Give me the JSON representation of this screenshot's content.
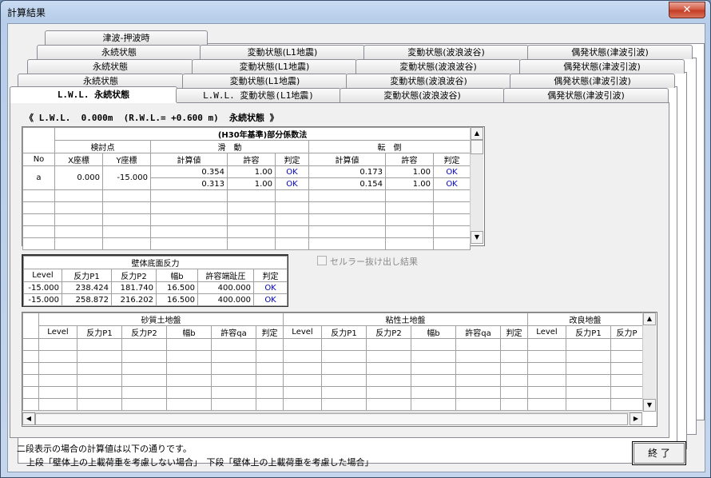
{
  "window": {
    "title": "計算結果",
    "close_glyph": "✕"
  },
  "tabs_row1": [
    "津波-押波時"
  ],
  "tabs_row2": [
    "永続状態",
    "変動状態(L1地震)",
    "変動状態(波浪波谷)",
    "偶発状態(津波引波)"
  ],
  "tabs_row3": [
    "永続状態",
    "変動状態(L1地震)",
    "変動状態(波浪波谷)",
    "偶発状態(津波引波)"
  ],
  "tabs_row4": [
    "永続状態",
    "変動状態(L1地震)",
    "変動状態(波浪波谷)",
    "偶発状態(津波引波)"
  ],
  "tabs_front": [
    "L.W.L. 永続状態",
    "L.W.L. 変動状態(L1地震)",
    "変動状態(波浪波谷)",
    "偶発状態(津波引波)"
  ],
  "heading": "《 L.W.L.  0.000m  (R.W.L.= +0.600 m)  永続状態 》",
  "main_table": {
    "title": "(H30年基準)部分係数法",
    "col_no": "No",
    "group_check": "検討点",
    "group_slide": "滑　動",
    "group_overturn": "転　倒",
    "x": "X座標",
    "y": "Y座標",
    "calc": "計算値",
    "allow": "許容",
    "judge": "判定",
    "rows": [
      {
        "no": "a",
        "x": "0.000",
        "y": "-15.000",
        "slide_calc": "0.354",
        "slide_allow": "1.00",
        "slide_judge": "OK",
        "ot_calc": "0.173",
        "ot_allow": "1.00",
        "ot_judge": "OK"
      },
      {
        "no": "",
        "x": "",
        "y": "",
        "slide_calc": "0.313",
        "slide_allow": "1.00",
        "slide_judge": "OK",
        "ot_calc": "0.154",
        "ot_allow": "1.00",
        "ot_judge": "OK"
      }
    ]
  },
  "reaction_table": {
    "title": "壁体底面反力",
    "headers": [
      "Level",
      "反力P1",
      "反力P2",
      "幅b",
      "許容端趾圧",
      "判定"
    ],
    "rows": [
      [
        "-15.000",
        "238.424",
        "181.740",
        "16.500",
        "400.000",
        "OK"
      ],
      [
        "-15.000",
        "258.872",
        "216.202",
        "16.500",
        "400.000",
        "OK"
      ]
    ]
  },
  "checkbox_label": "セルラー抜け出し結果",
  "ground_table": {
    "groups": [
      "砂質土地盤",
      "粘性土地盤",
      "改良地盤"
    ],
    "headers_sand": [
      "Level",
      "反力P1",
      "反力P2",
      "幅b",
      "許容qa",
      "判定"
    ],
    "headers_clay": [
      "Level",
      "反力P1",
      "反力P2",
      "幅b",
      "許容qa",
      "判定"
    ],
    "headers_improved": [
      "Level",
      "反力P1",
      "反力P"
    ]
  },
  "note_line1": "二段表示の場合の計算値は以下の通りです。",
  "note_line2": "上段「壁体上の上載荷重を考慮しない場合」　下段「壁体上の上載荷重を考慮した場合」",
  "end_button": "終 了"
}
